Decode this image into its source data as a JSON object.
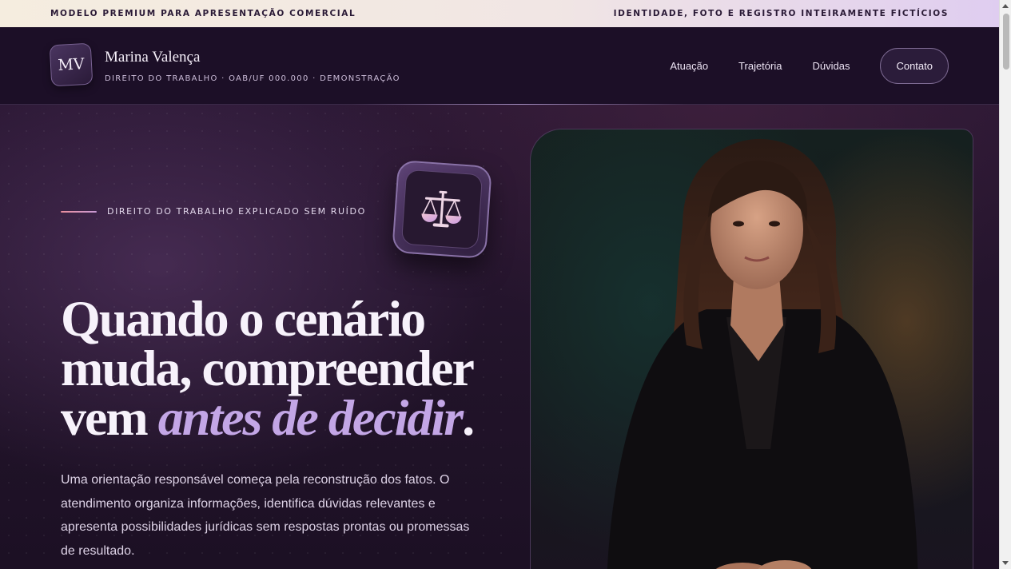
{
  "topbar": {
    "left_text": "MODELO PREMIUM PARA APRESENTAÇÃO COMERCIAL",
    "right_text": "IDENTIDADE, FOTO E REGISTRO INTEIRAMENTE FICTÍCIOS"
  },
  "header": {
    "logo_initials": "MV",
    "name": "Marina Valença",
    "subtitle": "DIREITO DO TRABALHO · OAB/UF 000.000 · DEMONSTRAÇÃO",
    "nav": [
      {
        "label": "Atuação"
      },
      {
        "label": "Trajetória"
      },
      {
        "label": "Dúvidas"
      }
    ],
    "contact_label": "Contato"
  },
  "hero": {
    "eyebrow": "DIREITO DO TRABALHO EXPLICADO SEM RUÍDO",
    "badge_icon": "scales-of-justice-icon",
    "headline_line1": "Quando o cenário",
    "headline_line2": "muda, compreender",
    "headline_line3_start": "vem ",
    "headline_accent": "antes de decidir",
    "headline_end": ".",
    "lead": "Uma orientação responsável começa pela reconstrução dos fatos. O atendimento organiza informações, identifica dúvidas relevantes e apresenta possibilidades jurídicas sem respostas prontas ou promessas de resultado.",
    "photo": "portrait-of-woman-in-black-blazer"
  },
  "colors": {
    "background": "#1d1126",
    "accent_purple": "#c3a6e6",
    "accent_pink": "#e88e9c",
    "topbar_start": "#f5eddf",
    "topbar_end": "#dfcdf0"
  }
}
